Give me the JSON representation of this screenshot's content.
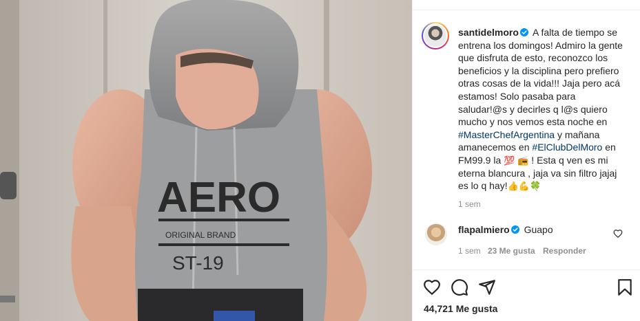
{
  "post": {
    "username": "santidelmoro",
    "caption_part1": "A falta de tiempo se entrena los domingos! Admiro la gente que disfruta de esto, reconozco los beneficios y la disciplina pero prefiero otras cosas de la vida!!! Jaja pero acá estamos! Solo pasaba para saludar!@s y decirles q l@s quiero mucho y nos vemos esta noche en ",
    "hashtag1": "#MasterChefArgentina",
    "caption_part2": " y mañana amanecemos en ",
    "hashtag2": "#ElClubDelMoro",
    "caption_part3": " en FM99.9 la ",
    "emoji_100": "💯",
    "emoji_radio": "📻",
    "caption_part4": " ! Esta q ven es mi eterna blancura , jaja va sin filtro jajaj es lo q hay!",
    "emoji_thumb": "👍",
    "emoji_muscle": "💪",
    "emoji_clover": "🍀",
    "time": "1 sem"
  },
  "comment": {
    "username": "flapalmiero",
    "text": "Guapo",
    "time": "1 sem",
    "likes": "23 Me gusta",
    "reply": "Responder"
  },
  "footer": {
    "likes": "44,721 Me gusta"
  },
  "photo": {
    "shirt_text": "AERO",
    "shirt_subtext": "ORIGINAL BRAND",
    "shirt_number": "ST-19"
  },
  "icons": [
    "verified-badge-icon",
    "heart-icon",
    "comment-icon",
    "share-icon",
    "bookmark-icon"
  ],
  "colors": {
    "verified": "#0095f6",
    "hashtag": "#00376b",
    "muted": "#8e8e8e",
    "text": "#262626"
  }
}
